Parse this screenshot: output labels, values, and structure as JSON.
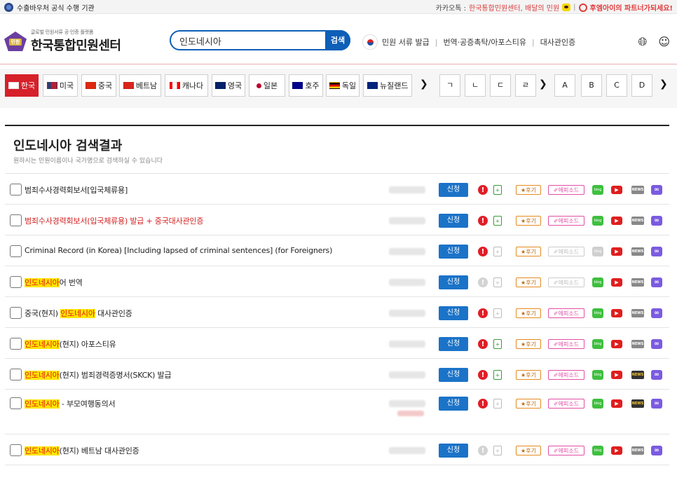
{
  "topbar": {
    "notice": "수출바우처 공식 수행 기관",
    "kakao_label": "카카오톡 : ",
    "kakao_link": "한국통합민원센터, 배달의 민원",
    "partner": "후엠아이의 파트너가되세요!"
  },
  "header": {
    "logo_sub": "글로벌 민원서류 공·인증 플랫폼",
    "logo_main": "한국통합민원센터",
    "logo_badge": "민원",
    "search_value": "인도네시아",
    "search_button": "검색",
    "nav": [
      "민원 서류 발급",
      "번역·공증촉탁/아포스티유",
      "대사관인증"
    ],
    "icons": [
      "globe-icon",
      "user-icon"
    ]
  },
  "country_tabs": [
    {
      "label": "한국",
      "colors": [
        "#ffffff",
        "#1c4fa8"
      ]
    },
    {
      "label": "미국",
      "colors": [
        "#b22234",
        "#3c3b6e"
      ]
    },
    {
      "label": "중국",
      "colors": [
        "#de2910",
        "#ffde00"
      ]
    },
    {
      "label": "베트남",
      "colors": [
        "#da251d",
        "#ffff00"
      ]
    },
    {
      "label": "캐나다",
      "colors": [
        "#ff0000",
        "#ffffff"
      ]
    },
    {
      "label": "영국",
      "colors": [
        "#012169",
        "#c8102e"
      ]
    },
    {
      "label": "일본",
      "colors": [
        "#ffffff",
        "#bc002d"
      ]
    },
    {
      "label": "호주",
      "colors": [
        "#00008b",
        "#ff0000"
      ]
    },
    {
      "label": "독일",
      "colors": [
        "#000000",
        "#dd0000"
      ]
    },
    {
      "label": "뉴질랜드",
      "colors": [
        "#00247d",
        "#cc142b"
      ]
    }
  ],
  "letter_tabs": [
    "ㄱ",
    "ㄴ",
    "ㄷ",
    "ㄹ",
    "A",
    "B",
    "C",
    "D"
  ],
  "results": {
    "title": "인도네시아 검색결과",
    "subtitle": "원하시는 민원이름이나 국가명으로 검색하실 수 있습니다",
    "apply_label": "신청",
    "review_label": "★후기",
    "episode_label": "✐에피소드",
    "blog_label": "blog",
    "news_label": "NEWS",
    "rows": [
      {
        "pre": "범죄수사경력회보서[입국체류용]",
        "hl": "",
        "post": "",
        "red": false,
        "alert": true,
        "doc": true,
        "episode": true,
        "blog": true,
        "news": false,
        "two_prices": false
      },
      {
        "pre": "범죄수사경력회보서(입국체류용) 발급 + 중국대사관인증",
        "hl": "",
        "post": "",
        "red": true,
        "alert": true,
        "doc": true,
        "episode": true,
        "blog": true,
        "news": false,
        "two_prices": false
      },
      {
        "pre": "Criminal Record (in Korea) [Including lapsed of criminal sentences] (for Foreigners)",
        "hl": "",
        "post": "",
        "red": false,
        "alert": true,
        "doc": false,
        "episode": false,
        "blog": false,
        "news": false,
        "two_prices": false
      },
      {
        "pre": "",
        "hl": "인도네시아",
        "post": "어 번역",
        "red": false,
        "alert": false,
        "doc": false,
        "episode": false,
        "blog": true,
        "news": false,
        "two_prices": false
      },
      {
        "pre": "중국(현지) ",
        "hl": "인도네시아",
        "post": " 대사관인증",
        "red": false,
        "alert": true,
        "doc": false,
        "episode": true,
        "blog": true,
        "news": false,
        "two_prices": false
      },
      {
        "pre": "",
        "hl": "인도네시아",
        "post": "(현지) 아포스티유",
        "red": false,
        "alert": true,
        "doc": true,
        "episode": true,
        "blog": true,
        "news": false,
        "two_prices": false
      },
      {
        "pre": "",
        "hl": "인도네시아",
        "post": "(현지) 범죄경력증명서(SKCK) 발급",
        "red": false,
        "alert": true,
        "doc": true,
        "episode": true,
        "blog": true,
        "news": true,
        "two_prices": false
      },
      {
        "pre": "",
        "hl": "인도네시아",
        "post": " - 부모여행동의서",
        "red": false,
        "alert": true,
        "doc": false,
        "episode": true,
        "blog": true,
        "news": true,
        "two_prices": true
      },
      {
        "pre": "",
        "hl": "인도네시아",
        "post": "(현지) 베트남 대사관인증",
        "red": false,
        "alert": false,
        "doc": false,
        "episode": true,
        "blog": true,
        "news": false,
        "two_prices": false
      }
    ]
  }
}
